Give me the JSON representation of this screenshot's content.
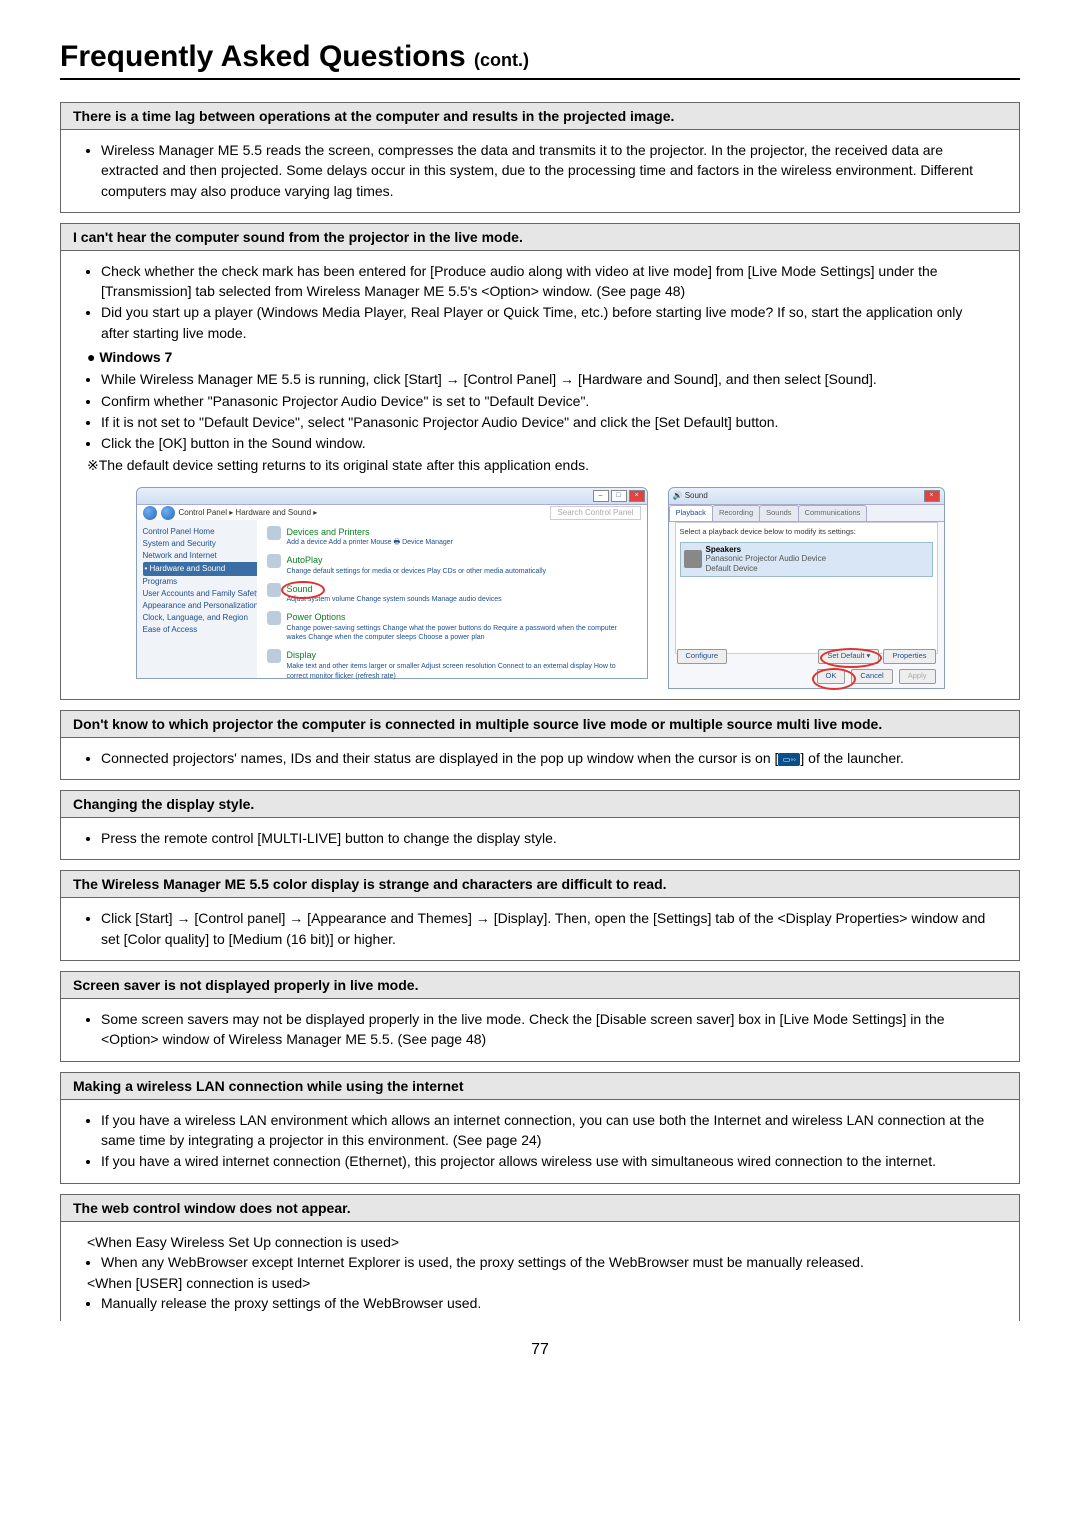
{
  "title": "Frequently Asked Questions",
  "title_suffix": "(cont.)",
  "page_number": "77",
  "faq": {
    "q1": {
      "question": "There is a time lag between operations at the computer and results in the projected image.",
      "a1": "Wireless Manager ME 5.5 reads the screen, compresses the data and transmits it to the projector. In the projector, the received data are extracted and then projected. Some delays occur in this system, due to the processing time and factors in the wireless environment. Different computers may also produce varying lag times."
    },
    "q2": {
      "question": "I can't hear the computer sound from the projector in the live mode.",
      "a1": "Check whether the check mark has been entered for [Produce audio along with video at live mode] from [Live Mode Settings] under the [Transmission] tab selected from Wireless Manager ME 5.5's <Option> window. (See page 48)",
      "a2": "Did you start up a player (Windows Media Player, Real Player or Quick Time, etc.) before starting live mode? If so, start the application only after starting live mode.",
      "sub_head": "● Windows 7",
      "a3": "While Wireless Manager ME 5.5 is running, click [Start] → [Control Panel] → [Hardware and Sound], and then select [Sound].",
      "a4": "Confirm whether \"Panasonic Projector Audio Device\" is set to \"Default Device\".",
      "a5": "If it is not set to \"Default Device\", select \"Panasonic Projector Audio Device\" and click the [Set Default] button.",
      "a6": "Click the [OK] button in the Sound window.",
      "a7": "※The default device setting returns to its original state after this application ends."
    },
    "q3": {
      "question": "Don't know to which projector the computer is connected in multiple source live mode or multiple source multi live mode.",
      "a1_pre": "Connected projectors' names, IDs and their status are displayed in the pop up window when the cursor is on [",
      "a1_post": "] of the launcher."
    },
    "q4": {
      "question": "Changing the display style.",
      "a1": "Press the remote control [MULTI-LIVE] button to change the display style."
    },
    "q5": {
      "question": "The Wireless Manager ME 5.5 color display is strange and characters are difficult to read.",
      "a1": "Click [Start] → [Control panel] → [Appearance and Themes] → [Display]. Then, open the [Settings] tab of the <Display Properties> window and set [Color quality] to [Medium (16 bit)] or higher."
    },
    "q6": {
      "question": "Screen saver is not displayed properly in live mode.",
      "a1": "Some screen savers may not be displayed properly in the live mode. Check the [Disable screen saver] box in [Live Mode Settings] in the <Option> window of Wireless Manager ME 5.5. (See page 48)"
    },
    "q7": {
      "question": "Making a wireless LAN connection while using the internet",
      "a1": "If you have a wireless LAN environment which allows an internet connection, you can use both the Internet and wireless LAN connection at the same time by integrating a projector in this environment. (See page 24)",
      "a2": "If you have a wired internet connection (Ethernet), this projector allows wireless use with simultaneous wired connection to the internet."
    },
    "q8": {
      "question": "The web control window does not appear.",
      "n1": "<When Easy Wireless Set Up connection is used>",
      "a1": "When any WebBrowser except Internet Explorer is used, the proxy settings of the WebBrowser must be manually released.",
      "n2": "<When [USER] connection is used>",
      "a2": "Manually release the proxy settings of the WebBrowser used."
    }
  },
  "cp": {
    "breadcrumb": "Control Panel ▸ Hardware and Sound ▸",
    "search": "Search Control Panel",
    "sidebar": {
      "home": "Control Panel Home",
      "i1": "System and Security",
      "i2": "Network and Internet",
      "i3": "Hardware and Sound",
      "i4": "Programs",
      "i5": "User Accounts and Family Safety",
      "i6": "Appearance and Personalization",
      "i7": "Clock, Language, and Region",
      "i8": "Ease of Access"
    },
    "items": {
      "dp": {
        "title": "Devices and Printers",
        "links": "Add a device   Add a printer   Mouse   🖶 Device Manager"
      },
      "ap": {
        "title": "AutoPlay",
        "links": "Change default settings for media or devices   Play CDs or other media automatically"
      },
      "snd": {
        "title": "Sound",
        "links": "Adjust system volume   Change system sounds   Manage audio devices"
      },
      "pw": {
        "title": "Power Options",
        "links": "Change power-saving settings   Change what the power buttons do   Require a password when the computer wakes   Change when the computer sleeps   Choose a power plan"
      },
      "disp": {
        "title": "Display",
        "links": "Make text and other items larger or smaller   Adjust screen resolution   Connect to an external display   How to correct monitor flicker (refresh rate)"
      }
    }
  },
  "sound": {
    "title": "Sound",
    "tab1": "Playback",
    "tab2": "Recording",
    "tab3": "Sounds",
    "tab4": "Communications",
    "hint": "Select a playback device below to modify its settings:",
    "dev_name": "Speakers",
    "dev_desc": "Panasonic Projector Audio Device",
    "dev_status": "Default Device",
    "btn_conf": "Configure",
    "btn_def": "Set Default ▾",
    "btn_prop": "Properties",
    "btn_ok": "OK",
    "btn_cancel": "Cancel",
    "btn_apply": "Apply"
  }
}
